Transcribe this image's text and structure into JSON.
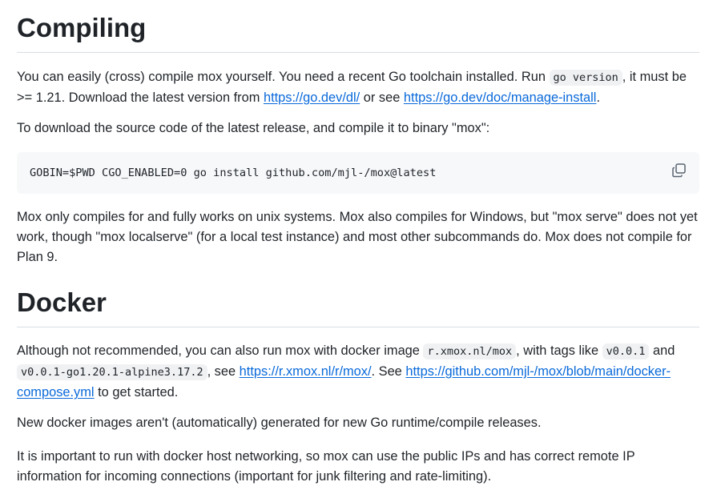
{
  "compiling": {
    "heading": "Compiling",
    "p1": {
      "t1": "You can easily (cross) compile mox yourself. You need a recent Go toolchain installed. Run ",
      "code1": "go version",
      "t2": ", it must be >= 1.21. Download the latest version from ",
      "link1": "https://go.dev/dl/",
      "t3": " or see ",
      "link2": "https://go.dev/doc/manage-install",
      "t4": "."
    },
    "p2": "To download the source code of the latest release, and compile it to binary \"mox\":",
    "command": "GOBIN=$PWD CGO_ENABLED=0 go install github.com/mjl-/mox@latest",
    "copy_icon": "copy-icon",
    "p3": "Mox only compiles for and fully works on unix systems. Mox also compiles for Windows, but \"mox serve\" does not yet work, though \"mox localserve\" (for a local test instance) and most other subcommands do. Mox does not compile for Plan 9."
  },
  "docker": {
    "heading": "Docker",
    "p1": {
      "t1": "Although not recommended, you can also run mox with docker image ",
      "code1": "r.xmox.nl/mox",
      "t2": ", with tags like ",
      "code2": "v0.0.1",
      "t3": " and ",
      "code3": "v0.0.1-go1.20.1-alpine3.17.2",
      "t4": ", see ",
      "link1": "https://r.xmox.nl/r/mox/",
      "t5": ". See ",
      "link2": "https://github.com/mjl-/mox/blob/main/docker-compose.yml",
      "t6": " to get started."
    },
    "p2": "New docker images aren't (automatically) generated for new Go runtime/compile releases.",
    "p3": "It is important to run with docker host networking, so mox can use the public IPs and has correct remote IP information for incoming connections (important for junk filtering and rate-limiting)."
  }
}
